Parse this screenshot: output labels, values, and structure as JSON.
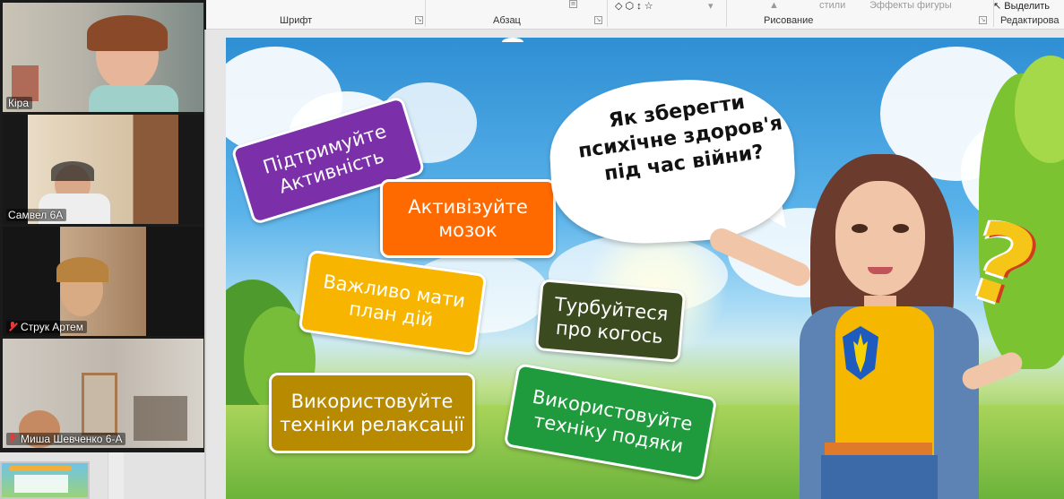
{
  "ribbon": {
    "groups": [
      {
        "label": "Шрифт"
      },
      {
        "label": "Абзац"
      },
      {
        "label": "Рисование"
      },
      {
        "label": "Редактирова"
      }
    ],
    "styles_label": "стили",
    "effects_label": "Эффекты фигуры",
    "select_label": "Выделить"
  },
  "participants": [
    {
      "name": "Кіра",
      "muted": false
    },
    {
      "name": "Самвел 6А",
      "muted": false
    },
    {
      "name": "Струк Артем",
      "muted": true
    },
    {
      "name": "Миша Шевченко 6-А",
      "muted": true
    }
  ],
  "slide": {
    "question": "Як зберегти психічне здоров'я під час війни?",
    "tips": [
      {
        "text": "Підтримуйте Активність",
        "color": "#7b2fa8"
      },
      {
        "text": "Активізуйте мозок",
        "color": "#ff6a00"
      },
      {
        "text": "Важливо мати план дій",
        "color": "#f7b500"
      },
      {
        "text": "Турбуйтеся про когось",
        "color": "#3b4b1f"
      },
      {
        "text": "Використовуйте техніки релаксації",
        "color": "#b88a00"
      },
      {
        "text": "Використовуйте техніку подяки",
        "color": "#1f9a3c"
      }
    ],
    "question_mark": "?"
  }
}
